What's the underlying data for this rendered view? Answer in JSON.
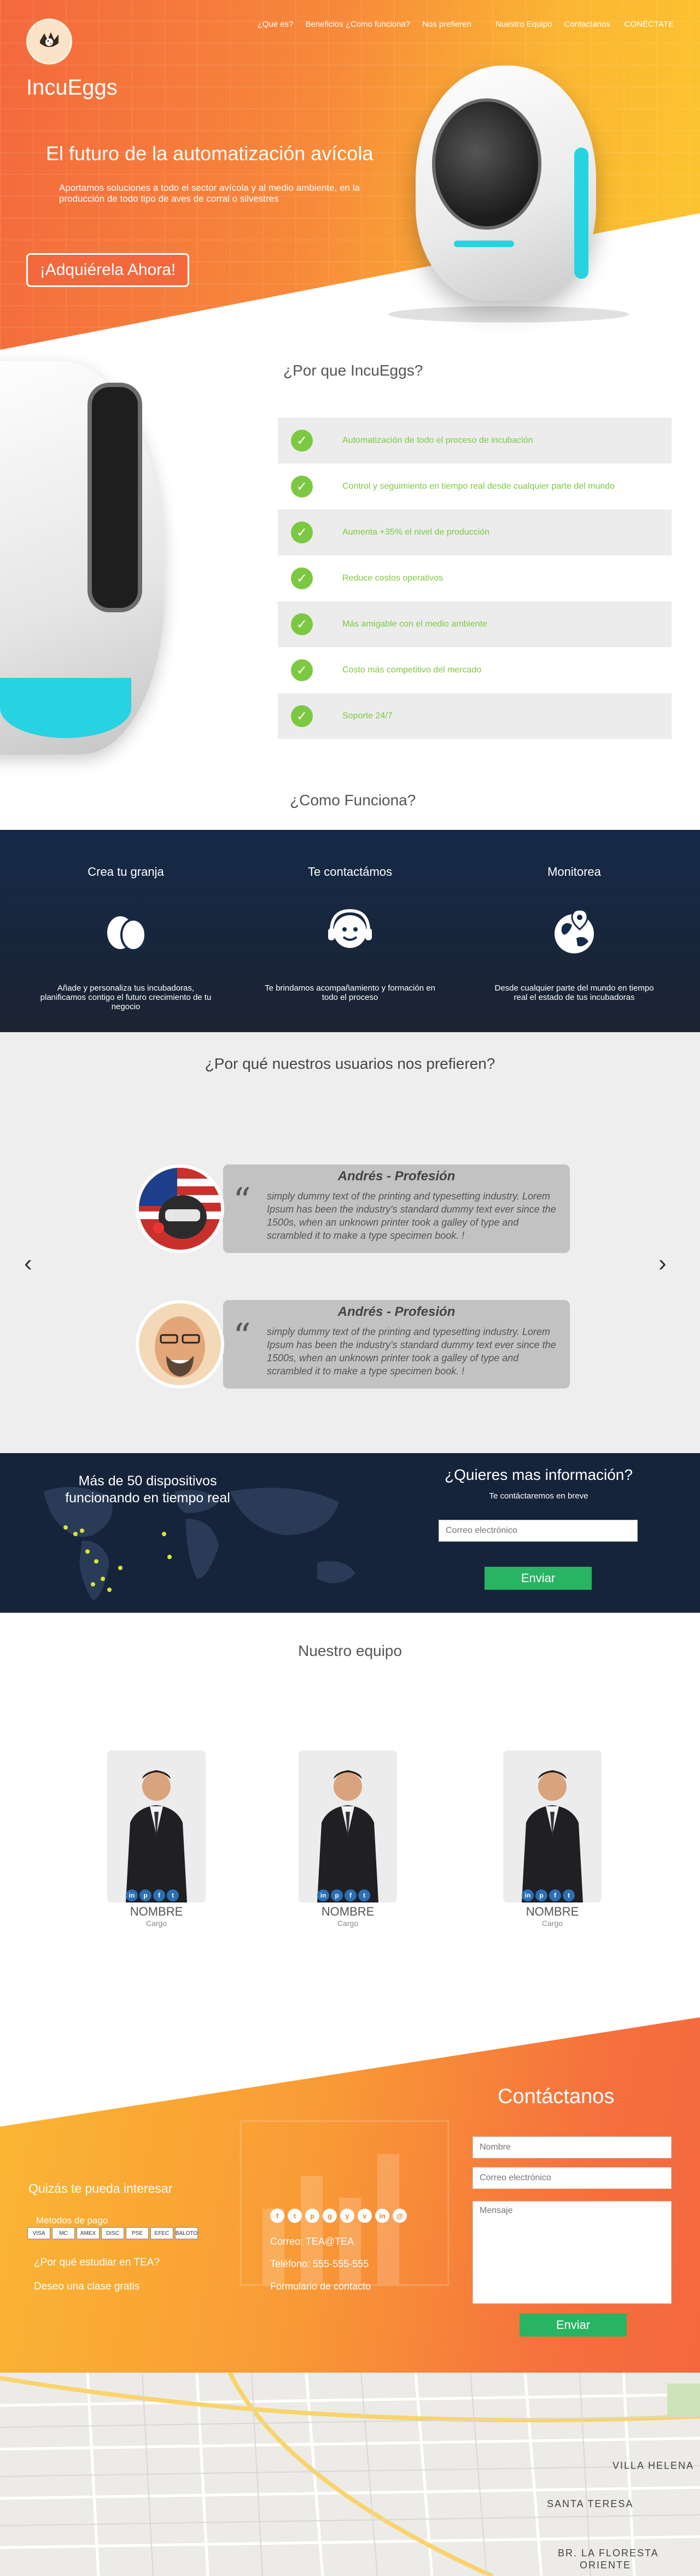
{
  "nav": {
    "items": [
      "¿Que es?",
      "Beneficios",
      "¿Como funciona?",
      "Nos prefieren",
      "Nuestro Equipo",
      "Contactanos",
      "CONÉCTATE"
    ]
  },
  "brand": {
    "name": "IncuEggs"
  },
  "hero": {
    "title": "El futuro de la automatización avícola",
    "subtitle": "Aportamos soluciones a todo el sector avícola y al medio ambiente, en la producción de todo tipo de aves de corral o silvestres",
    "cta": "¡Adquiérela Ahora!"
  },
  "why": {
    "title": "¿Por que IncuEggs?",
    "items": [
      "Automatización de todo el proceso de incubación",
      "Control y seguimiento en tiempo real desde cualquier parte del mundo",
      "Aumenta +35% el nivel de producción",
      "Reduce costos operativos",
      "Más amigable con el medio ambiente",
      "Costo más competitivo del mercado",
      "Soporte 24/7"
    ]
  },
  "how": {
    "title": "¿Como Funciona?",
    "steps": [
      {
        "title": "Crea tu granja",
        "text": "Añade y personaliza tus incubadoras, planificamos contigo el futuro crecimiento de tu negocio",
        "icon": "eggs-icon"
      },
      {
        "title": "Te contactámos",
        "text": "Te brindamos acompañamiento  y formación en todo el proceso",
        "icon": "support-agent-icon"
      },
      {
        "title": "Monitorea",
        "text": "Desde cualquier parte del mundo en tiempo real el estado de tus incubadoras",
        "icon": "globe-pin-icon"
      }
    ]
  },
  "testimonials": {
    "title": "¿Por qué nuestros usuarios nos prefieren?",
    "prev": "‹",
    "next": "›",
    "items": [
      {
        "name": "Andrés - Profesión",
        "text": "simply dummy text of the printing and typesetting industry. Lorem Ipsum has been the industry's standard dummy text ever since the 1500s, when an unknown printer took a galley of type and scrambled it to make a type specimen book. !"
      },
      {
        "name": "Andrés - Profesión",
        "text": "simply dummy text of the printing and typesetting industry. Lorem Ipsum has been the industry's standard dummy text ever since the 1500s, when an unknown printer took a galley of type and scrambled it to make a type specimen book. !"
      }
    ]
  },
  "info": {
    "devices": "Más de 50 dispositivos funcionando en tiempo real",
    "title": "¿Quieres mas información?",
    "subtitle": "Te contáctaremos en breve",
    "email_placeholder": "Correo electrónico",
    "button": "Enviar"
  },
  "team": {
    "title": "Nuestro equipo",
    "members": [
      {
        "name": "NOMBRE",
        "role": "Cargo"
      },
      {
        "name": "NOMBRE",
        "role": "Cargo"
      },
      {
        "name": "NOMBRE",
        "role": "Cargo"
      }
    ]
  },
  "contact": {
    "title": "Contáctanos",
    "name_placeholder": "Nombre",
    "email_placeholder": "Correo electrónico",
    "message_placeholder": "Mensaje",
    "button": "Enviar",
    "interest": "Quizás te pueda interesar",
    "payment_label": "Metodos de pago",
    "payment_methods": [
      "VISA",
      "MC",
      "AMEX",
      "DISC",
      "PSE",
      "EFEC",
      "BALOTO"
    ],
    "links": [
      "¿Por qué estudiar en TEA?",
      "Deseo una clase gratis"
    ],
    "phone_line": "Correo: TEA@TEA",
    "info": [
      "Correo: TEA@TEA",
      "Teléfono: 555-555-555",
      "Formulario de contacto"
    ],
    "socials": [
      "f",
      "t",
      "p",
      "g",
      "y",
      "v",
      "in",
      "@"
    ]
  },
  "map": {
    "labels": [
      "VILLA HELENA",
      "SANTA TERESA",
      "BR. LA FLORESTA",
      "ORIENTE"
    ]
  },
  "colors": {
    "orange": "#f4683d",
    "yellow": "#fcc52f",
    "green": "#7dc843",
    "navy": "#16243b",
    "button_green": "#28b462",
    "cyan": "#27d3e0"
  }
}
